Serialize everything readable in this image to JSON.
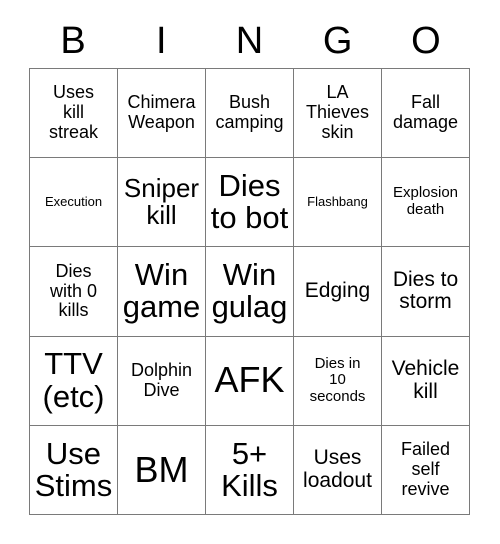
{
  "card": {
    "title_letters": [
      "B",
      "I",
      "N",
      "G",
      "O"
    ],
    "columns": 5,
    "rows": 5,
    "text_color": "#000000",
    "background_color": "#ffffff",
    "border_color": "#7a7a7a"
  },
  "cells": [
    {
      "text": "Uses\nkill\nstreak",
      "size": "md"
    },
    {
      "text": "Chimera\nWeapon",
      "size": "md"
    },
    {
      "text": "Bush\ncamping",
      "size": "md"
    },
    {
      "text": "LA\nThieves\nskin",
      "size": "md"
    },
    {
      "text": "Fall\ndamage",
      "size": "md"
    },
    {
      "text": "Execution",
      "size": "xs"
    },
    {
      "text": "Sniper\nkill",
      "size": "xl"
    },
    {
      "text": "Dies\nto bot",
      "size": "xxl"
    },
    {
      "text": "Flashbang",
      "size": "xs"
    },
    {
      "text": "Explosion\ndeath",
      "size": "sm"
    },
    {
      "text": "Dies\nwith 0\nkills",
      "size": "md"
    },
    {
      "text": "Win\ngame",
      "size": "xxl"
    },
    {
      "text": "Win\ngulag",
      "size": "xxl"
    },
    {
      "text": "Edging",
      "size": "lg"
    },
    {
      "text": "Dies to\nstorm",
      "size": "lg"
    },
    {
      "text": "TTV\n(etc)",
      "size": "xxl"
    },
    {
      "text": "Dolphin\nDive",
      "size": "md"
    },
    {
      "text": "AFK",
      "size": "huge"
    },
    {
      "text": "Dies in\n10\nseconds",
      "size": "sm"
    },
    {
      "text": "Vehicle\nkill",
      "size": "lg"
    },
    {
      "text": "Use\nStims",
      "size": "xxl"
    },
    {
      "text": "BM",
      "size": "huge"
    },
    {
      "text": "5+\nKills",
      "size": "xxl"
    },
    {
      "text": "Uses\nloadout",
      "size": "lg"
    },
    {
      "text": "Failed\nself\nrevive",
      "size": "md"
    }
  ]
}
